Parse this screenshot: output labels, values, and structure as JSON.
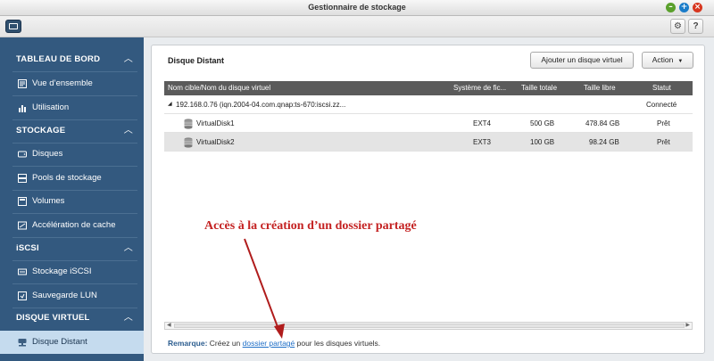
{
  "window": {
    "title": "Gestionnaire de stockage"
  },
  "sidebar": {
    "sections": [
      {
        "label": "TABLEAU DE BORD",
        "items": [
          "Vue d’ensemble",
          "Utilisation"
        ]
      },
      {
        "label": "STOCKAGE",
        "items": [
          "Disques",
          "Pools de stockage",
          "Volumes",
          "Accélération de cache"
        ]
      },
      {
        "label": "iSCSI",
        "items": [
          "Stockage iSCSI",
          "Sauvegarde LUN"
        ]
      },
      {
        "label": "DISQUE VIRTUEL",
        "items": [
          "Disque Distant"
        ]
      }
    ],
    "active_item": "Disque Distant"
  },
  "main": {
    "title": "Disque Distant",
    "add_button": "Ajouter un disque virtuel",
    "action_button": "Action",
    "columns": [
      "Nom cible/Nom du disque virtuel",
      "Système de fic...",
      "Taille totale",
      "Taille libre",
      "Statut"
    ],
    "target": {
      "name": "192.168.0.76 (iqn.2004-04.com.qnap:ts-670:iscsi.zz...",
      "status": "Connecté"
    },
    "disks": [
      {
        "name": "VirtualDisk1",
        "fs": "EXT4",
        "total": "500 GB",
        "free": "478.84 GB",
        "status": "Prêt"
      },
      {
        "name": "VirtualDisk2",
        "fs": "EXT3",
        "total": "100 GB",
        "free": "98.24 GB",
        "status": "Prêt"
      }
    ],
    "note": {
      "label": "Remarque:",
      "text_before": "Créez un",
      "link": "dossier partagé",
      "text_after": "pour les disques virtuels."
    }
  },
  "annotation": {
    "text": "Accès à la création d’un dossier partagé",
    "color": "#c42222"
  }
}
